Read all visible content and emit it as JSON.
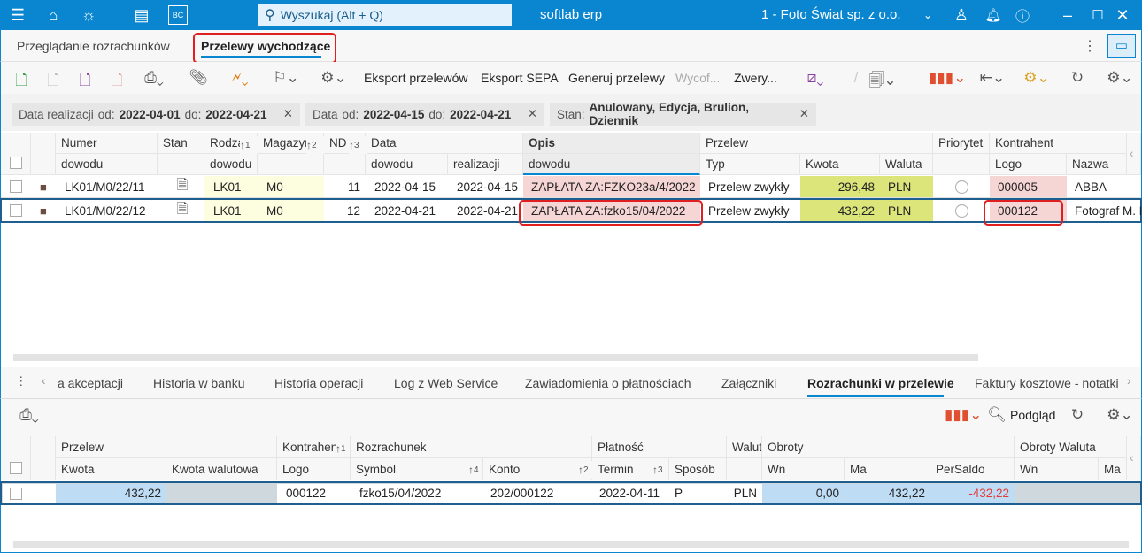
{
  "titlebar": {
    "search_placeholder": "Wyszukaj (Alt + Q)",
    "app_name": "softlab erp",
    "company": "1 - Foto Świat sp. z o.o.",
    "bc_label": "BC"
  },
  "tabs": [
    {
      "label": "Przeglądanie rozrachunków",
      "active": false
    },
    {
      "label": "Przelewy wychodzące",
      "active": true
    }
  ],
  "toolbar": {
    "export_transfers": "Eksport przelewów",
    "export_sepa": "Eksport SEPA",
    "generate_transfers": "Generuj przelewy",
    "withdraw": "Wycof...",
    "verify": "Zwery..."
  },
  "filters": [
    {
      "label": "Data realizacji",
      "from_label": "od:",
      "from": "2022-04-01",
      "to_label": "do:",
      "to": "2022-04-21"
    },
    {
      "label": "Data",
      "from_label": "od:",
      "from": "2022-04-15",
      "to_label": "do:",
      "to": "2022-04-21"
    },
    {
      "label": "Stan:",
      "value": "Anulowany, Edycja, Brulion, Dziennik"
    }
  ],
  "main_grid": {
    "group_headers": {
      "numer": "Numer",
      "stan": "Stan",
      "rodzaj": "Rodzaj",
      "magazyn": "Magazyn",
      "nd": "ND",
      "data": "Data",
      "opis": "Opis",
      "przelew": "Przelew",
      "priorytet": "Priorytet",
      "kontrahent": "Kontrahent"
    },
    "sub_headers": {
      "numer": "dowodu",
      "rodzaj": "dowodu",
      "data_dowodu": "dowodu",
      "data_realizacji": "realizacji",
      "opis": "dowodu",
      "typ": "Typ",
      "kwota": "Kwota",
      "waluta": "Waluta",
      "logo": "Logo",
      "nazwa": "Nazwa"
    },
    "sort_indices": {
      "rodzaj": "1",
      "magazyn": "2",
      "nd": "3"
    },
    "rows": [
      {
        "numer": "LK01/M0/22/11",
        "rodzaj": "LK01",
        "magazyn": "M0",
        "nd": "11",
        "data_dowodu": "2022-04-15",
        "data_realizacji": "2022-04-15",
        "opis": "ZAPŁATA ZA:FZKO23a/4/2022",
        "typ": "Przelew zwykły",
        "kwota": "296,48",
        "waluta": "PLN",
        "logo": "000005",
        "nazwa": "ABBA",
        "selected": false
      },
      {
        "numer": "LK01/M0/22/12",
        "rodzaj": "LK01",
        "magazyn": "M0",
        "nd": "12",
        "data_dowodu": "2022-04-21",
        "data_realizacji": "2022-04-21",
        "opis": "ZAPŁATA ZA:fzko15/04/2022",
        "typ": "Przelew zwykły",
        "kwota": "432,22",
        "waluta": "PLN",
        "logo": "000122",
        "nazwa": "Fotograf M. M",
        "selected": true
      }
    ]
  },
  "bottom_tabs": [
    {
      "label": "a akceptacji"
    },
    {
      "label": "Historia w banku"
    },
    {
      "label": "Historia operacji"
    },
    {
      "label": "Log z Web Service"
    },
    {
      "label": "Zawiadomienia o płatnościach"
    },
    {
      "label": "Załączniki"
    },
    {
      "label": "Rozrachunki w przelewie",
      "active": true
    },
    {
      "label": "Faktury kosztowe - notatki"
    }
  ],
  "bottom_toolbar": {
    "preview": "Podgląd"
  },
  "bottom_grid": {
    "group_headers": {
      "przelew": "Przelew",
      "kontrahent": "Kontrahent",
      "rozrachunek": "Rozrachunek",
      "platnosc": "Płatność",
      "waluta": "Walut",
      "obroty": "Obroty",
      "obroty_waluta": "Obroty Waluta"
    },
    "sub_headers": {
      "kwota": "Kwota",
      "kwota_walutowa": "Kwota walutowa",
      "logo": "Logo",
      "symbol": "Symbol",
      "konto": "Konto",
      "termin": "Termin",
      "sposob": "Sposób",
      "wn": "Wn",
      "ma": "Ma",
      "persaldo": "PerSaldo",
      "wn2": "Wn",
      "ma2": "Ma"
    },
    "sort_indices": {
      "kontrahent": "1",
      "symbol": "4",
      "konto": "2",
      "termin": "3"
    },
    "rows": [
      {
        "kwota": "432,22",
        "kwota_walutowa": "",
        "logo": "000122",
        "symbol": "fzko15/04/2022",
        "konto": "202/000122",
        "termin": "2022-04-11",
        "sposob": "P",
        "waluta": "PLN",
        "wn": "0,00",
        "ma": "432,22",
        "persaldo": "-432,22",
        "wn2": "",
        "ma2": ""
      }
    ]
  },
  "colors": {
    "accent": "#0a86d1",
    "highlight_red": "#e02020",
    "negative": "#e53935",
    "amount_bg": "#dbe57a",
    "logo_bg": "#f6d5d5",
    "yellow_bg": "#fdfde0",
    "blue_cell": "#bfdcf5"
  }
}
